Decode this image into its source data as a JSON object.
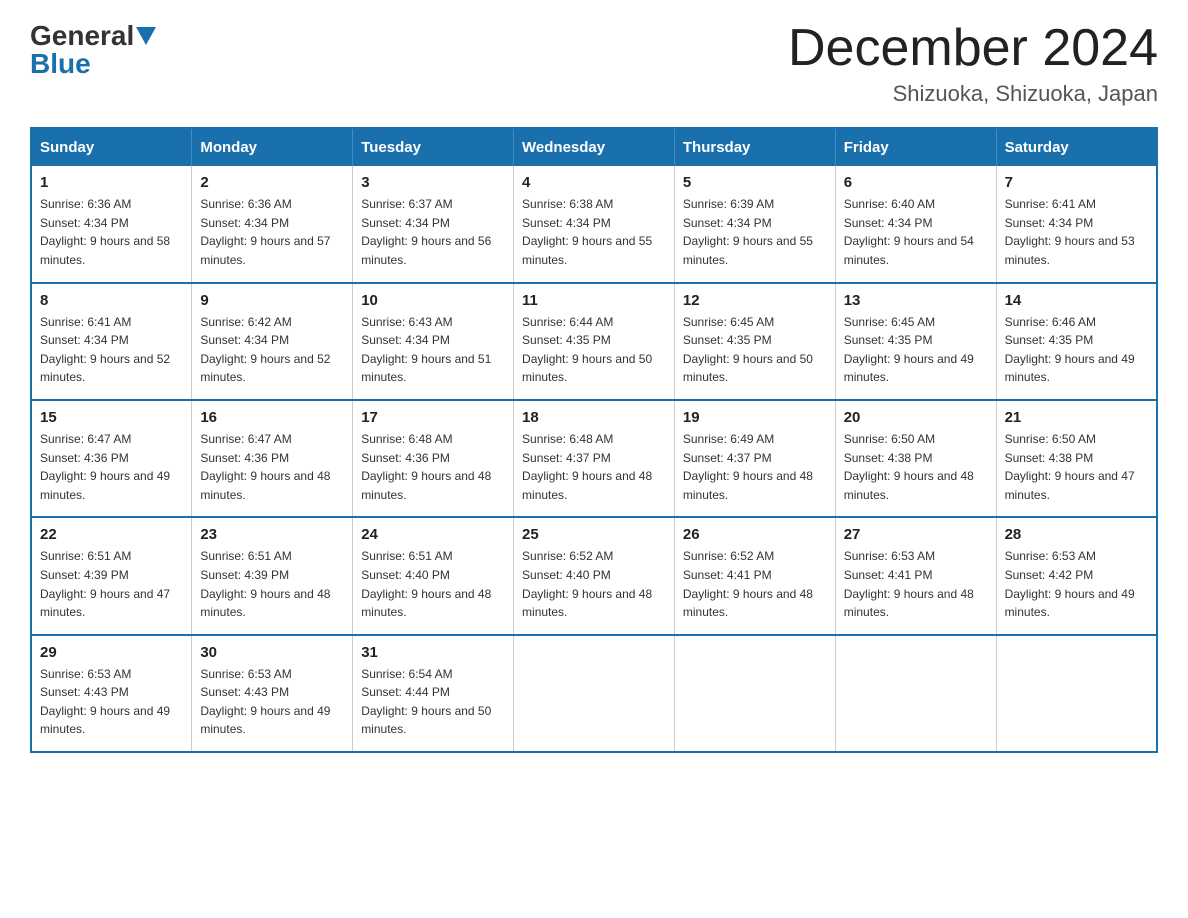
{
  "header": {
    "logo_general": "General",
    "logo_blue": "Blue",
    "month_title": "December 2024",
    "location": "Shizuoka, Shizuoka, Japan"
  },
  "days_of_week": [
    "Sunday",
    "Monday",
    "Tuesday",
    "Wednesday",
    "Thursday",
    "Friday",
    "Saturday"
  ],
  "weeks": [
    [
      {
        "day": "1",
        "sunrise": "Sunrise: 6:36 AM",
        "sunset": "Sunset: 4:34 PM",
        "daylight": "Daylight: 9 hours and 58 minutes."
      },
      {
        "day": "2",
        "sunrise": "Sunrise: 6:36 AM",
        "sunset": "Sunset: 4:34 PM",
        "daylight": "Daylight: 9 hours and 57 minutes."
      },
      {
        "day": "3",
        "sunrise": "Sunrise: 6:37 AM",
        "sunset": "Sunset: 4:34 PM",
        "daylight": "Daylight: 9 hours and 56 minutes."
      },
      {
        "day": "4",
        "sunrise": "Sunrise: 6:38 AM",
        "sunset": "Sunset: 4:34 PM",
        "daylight": "Daylight: 9 hours and 55 minutes."
      },
      {
        "day": "5",
        "sunrise": "Sunrise: 6:39 AM",
        "sunset": "Sunset: 4:34 PM",
        "daylight": "Daylight: 9 hours and 55 minutes."
      },
      {
        "day": "6",
        "sunrise": "Sunrise: 6:40 AM",
        "sunset": "Sunset: 4:34 PM",
        "daylight": "Daylight: 9 hours and 54 minutes."
      },
      {
        "day": "7",
        "sunrise": "Sunrise: 6:41 AM",
        "sunset": "Sunset: 4:34 PM",
        "daylight": "Daylight: 9 hours and 53 minutes."
      }
    ],
    [
      {
        "day": "8",
        "sunrise": "Sunrise: 6:41 AM",
        "sunset": "Sunset: 4:34 PM",
        "daylight": "Daylight: 9 hours and 52 minutes."
      },
      {
        "day": "9",
        "sunrise": "Sunrise: 6:42 AM",
        "sunset": "Sunset: 4:34 PM",
        "daylight": "Daylight: 9 hours and 52 minutes."
      },
      {
        "day": "10",
        "sunrise": "Sunrise: 6:43 AM",
        "sunset": "Sunset: 4:34 PM",
        "daylight": "Daylight: 9 hours and 51 minutes."
      },
      {
        "day": "11",
        "sunrise": "Sunrise: 6:44 AM",
        "sunset": "Sunset: 4:35 PM",
        "daylight": "Daylight: 9 hours and 50 minutes."
      },
      {
        "day": "12",
        "sunrise": "Sunrise: 6:45 AM",
        "sunset": "Sunset: 4:35 PM",
        "daylight": "Daylight: 9 hours and 50 minutes."
      },
      {
        "day": "13",
        "sunrise": "Sunrise: 6:45 AM",
        "sunset": "Sunset: 4:35 PM",
        "daylight": "Daylight: 9 hours and 49 minutes."
      },
      {
        "day": "14",
        "sunrise": "Sunrise: 6:46 AM",
        "sunset": "Sunset: 4:35 PM",
        "daylight": "Daylight: 9 hours and 49 minutes."
      }
    ],
    [
      {
        "day": "15",
        "sunrise": "Sunrise: 6:47 AM",
        "sunset": "Sunset: 4:36 PM",
        "daylight": "Daylight: 9 hours and 49 minutes."
      },
      {
        "day": "16",
        "sunrise": "Sunrise: 6:47 AM",
        "sunset": "Sunset: 4:36 PM",
        "daylight": "Daylight: 9 hours and 48 minutes."
      },
      {
        "day": "17",
        "sunrise": "Sunrise: 6:48 AM",
        "sunset": "Sunset: 4:36 PM",
        "daylight": "Daylight: 9 hours and 48 minutes."
      },
      {
        "day": "18",
        "sunrise": "Sunrise: 6:48 AM",
        "sunset": "Sunset: 4:37 PM",
        "daylight": "Daylight: 9 hours and 48 minutes."
      },
      {
        "day": "19",
        "sunrise": "Sunrise: 6:49 AM",
        "sunset": "Sunset: 4:37 PM",
        "daylight": "Daylight: 9 hours and 48 minutes."
      },
      {
        "day": "20",
        "sunrise": "Sunrise: 6:50 AM",
        "sunset": "Sunset: 4:38 PM",
        "daylight": "Daylight: 9 hours and 48 minutes."
      },
      {
        "day": "21",
        "sunrise": "Sunrise: 6:50 AM",
        "sunset": "Sunset: 4:38 PM",
        "daylight": "Daylight: 9 hours and 47 minutes."
      }
    ],
    [
      {
        "day": "22",
        "sunrise": "Sunrise: 6:51 AM",
        "sunset": "Sunset: 4:39 PM",
        "daylight": "Daylight: 9 hours and 47 minutes."
      },
      {
        "day": "23",
        "sunrise": "Sunrise: 6:51 AM",
        "sunset": "Sunset: 4:39 PM",
        "daylight": "Daylight: 9 hours and 48 minutes."
      },
      {
        "day": "24",
        "sunrise": "Sunrise: 6:51 AM",
        "sunset": "Sunset: 4:40 PM",
        "daylight": "Daylight: 9 hours and 48 minutes."
      },
      {
        "day": "25",
        "sunrise": "Sunrise: 6:52 AM",
        "sunset": "Sunset: 4:40 PM",
        "daylight": "Daylight: 9 hours and 48 minutes."
      },
      {
        "day": "26",
        "sunrise": "Sunrise: 6:52 AM",
        "sunset": "Sunset: 4:41 PM",
        "daylight": "Daylight: 9 hours and 48 minutes."
      },
      {
        "day": "27",
        "sunrise": "Sunrise: 6:53 AM",
        "sunset": "Sunset: 4:41 PM",
        "daylight": "Daylight: 9 hours and 48 minutes."
      },
      {
        "day": "28",
        "sunrise": "Sunrise: 6:53 AM",
        "sunset": "Sunset: 4:42 PM",
        "daylight": "Daylight: 9 hours and 49 minutes."
      }
    ],
    [
      {
        "day": "29",
        "sunrise": "Sunrise: 6:53 AM",
        "sunset": "Sunset: 4:43 PM",
        "daylight": "Daylight: 9 hours and 49 minutes."
      },
      {
        "day": "30",
        "sunrise": "Sunrise: 6:53 AM",
        "sunset": "Sunset: 4:43 PM",
        "daylight": "Daylight: 9 hours and 49 minutes."
      },
      {
        "day": "31",
        "sunrise": "Sunrise: 6:54 AM",
        "sunset": "Sunset: 4:44 PM",
        "daylight": "Daylight: 9 hours and 50 minutes."
      },
      null,
      null,
      null,
      null
    ]
  ]
}
